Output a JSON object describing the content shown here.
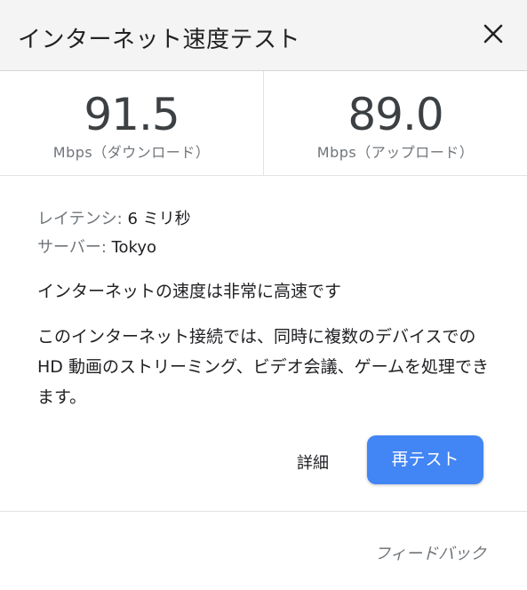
{
  "header": {
    "title": "インターネット速度テスト",
    "close_icon": "close-icon"
  },
  "speeds": {
    "download": {
      "value": "91.5",
      "unit": "Mbps（ダウンロード）"
    },
    "upload": {
      "value": "89.0",
      "unit": "Mbps（アップロード）"
    }
  },
  "details": {
    "latency_label": "レイテンシ: ",
    "latency_value": "6 ミリ秒",
    "server_label": "サーバー: ",
    "server_value": "Tokyo",
    "verdict": "インターネットの速度は非常に高速です",
    "description": "このインターネット接続では、同時に複数のデバイスでの HD 動画のストリーミング、ビデオ会議、ゲームを処理できます。"
  },
  "actions": {
    "details_label": "詳細",
    "retest_label": "再テスト"
  },
  "footer": {
    "feedback_label": "フィードバック"
  },
  "colors": {
    "accent": "#4285f4",
    "header_bg": "#f4f4f4",
    "muted_text": "#70757a"
  }
}
